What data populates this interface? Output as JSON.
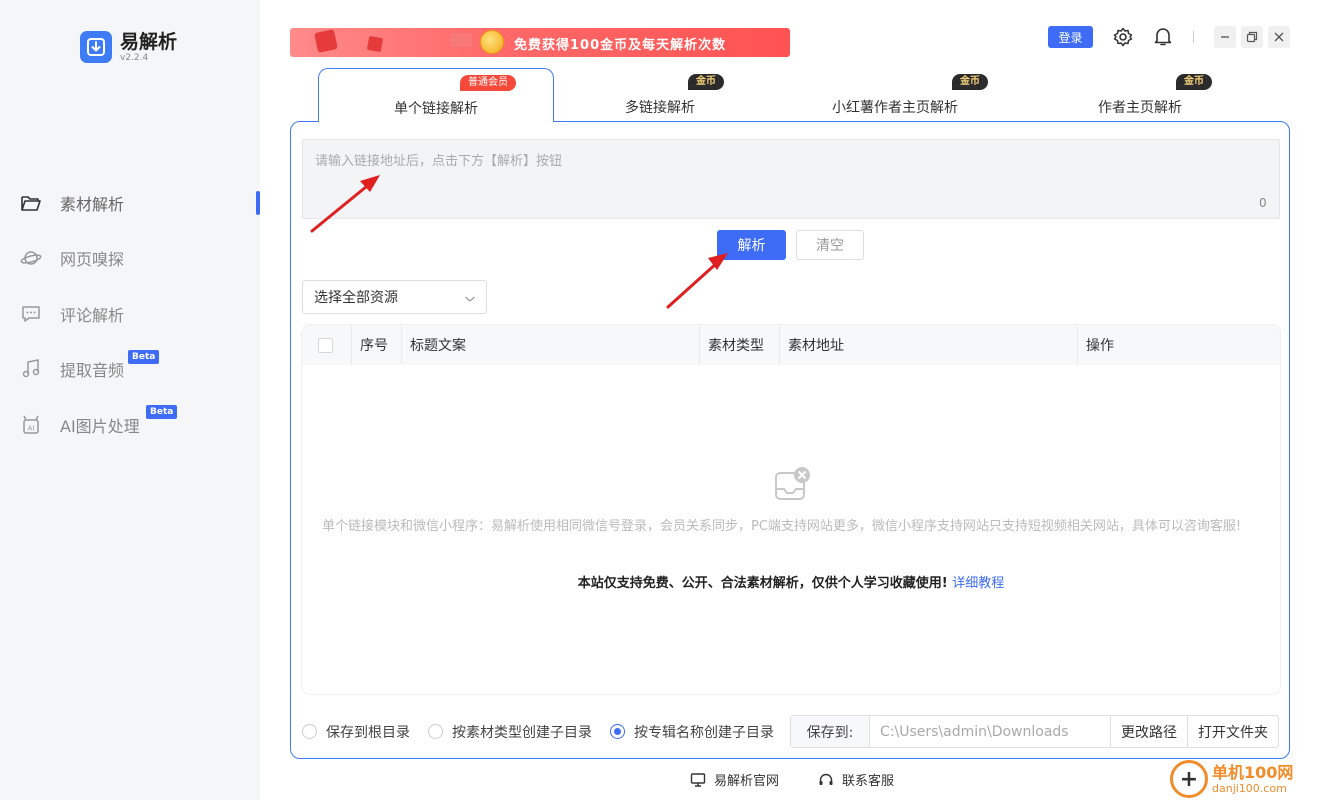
{
  "app": {
    "name": "易解析",
    "version": "v2.2.4"
  },
  "sidebar": {
    "items": [
      {
        "label": "素材解析",
        "icon": "folder-open-icon",
        "active": true
      },
      {
        "label": "网页嗅探",
        "icon": "planet-icon"
      },
      {
        "label": "评论解析",
        "icon": "comment-icon"
      },
      {
        "label": "提取音频",
        "icon": "music-note-icon",
        "badge": "Beta"
      },
      {
        "label": "AI图片处理",
        "icon": "ai-robot-icon",
        "badge": "Beta"
      }
    ]
  },
  "banner": {
    "text": "免费获得100金币及每天解析次数"
  },
  "header": {
    "login_label": "登录"
  },
  "tabs": [
    {
      "label": "单个链接解析",
      "badge": "普通会员",
      "active": true
    },
    {
      "label": "多链接解析",
      "badge": "金币"
    },
    {
      "label": "小红薯作者主页解析",
      "badge": "金币"
    },
    {
      "label": "作者主页解析",
      "badge": "金币"
    }
  ],
  "input": {
    "placeholder": "请输入链接地址后，点击下方【解析】按钮",
    "value": "",
    "count": "0"
  },
  "actions": {
    "parse_label": "解析",
    "clear_label": "清空"
  },
  "filter": {
    "selected": "选择全部资源"
  },
  "table": {
    "columns": [
      "序号",
      "标题文案",
      "素材类型",
      "素材地址",
      "操作"
    ],
    "rows": [],
    "empty_message": "单个链接模块和微信小程序：易解析使用相同微信号登录，会员关系同步，PC端支持网站更多，微信小程序支持网站只支持短视频相关网站，具体可以咨询客服!",
    "notice": "本站仅支持免费、公开、合法素材解析，仅供个人学习收藏使用!",
    "notice_link": "详细教程"
  },
  "save_options": {
    "radios": [
      {
        "label": "保存到根目录",
        "checked": false
      },
      {
        "label": "按素材类型创建子目录",
        "checked": false
      },
      {
        "label": "按专辑名称创建子目录",
        "checked": true
      }
    ],
    "save_to_label": "保存到:",
    "path": "C:\\Users\\admin\\Downloads",
    "change_path_label": "更改路径",
    "open_folder_label": "打开文件夹"
  },
  "footer": {
    "website_label": "易解析官网",
    "support_label": "联系客服"
  },
  "watermark": {
    "title": "单机100网",
    "url": "danji100.com"
  },
  "colors": {
    "accent": "#3e6cf6",
    "tab_border": "#3e7bf7",
    "member_badge": "#f54a3b",
    "gold_badge_bg": "#2b2b2b",
    "annotation_arrow": "#e02020"
  }
}
